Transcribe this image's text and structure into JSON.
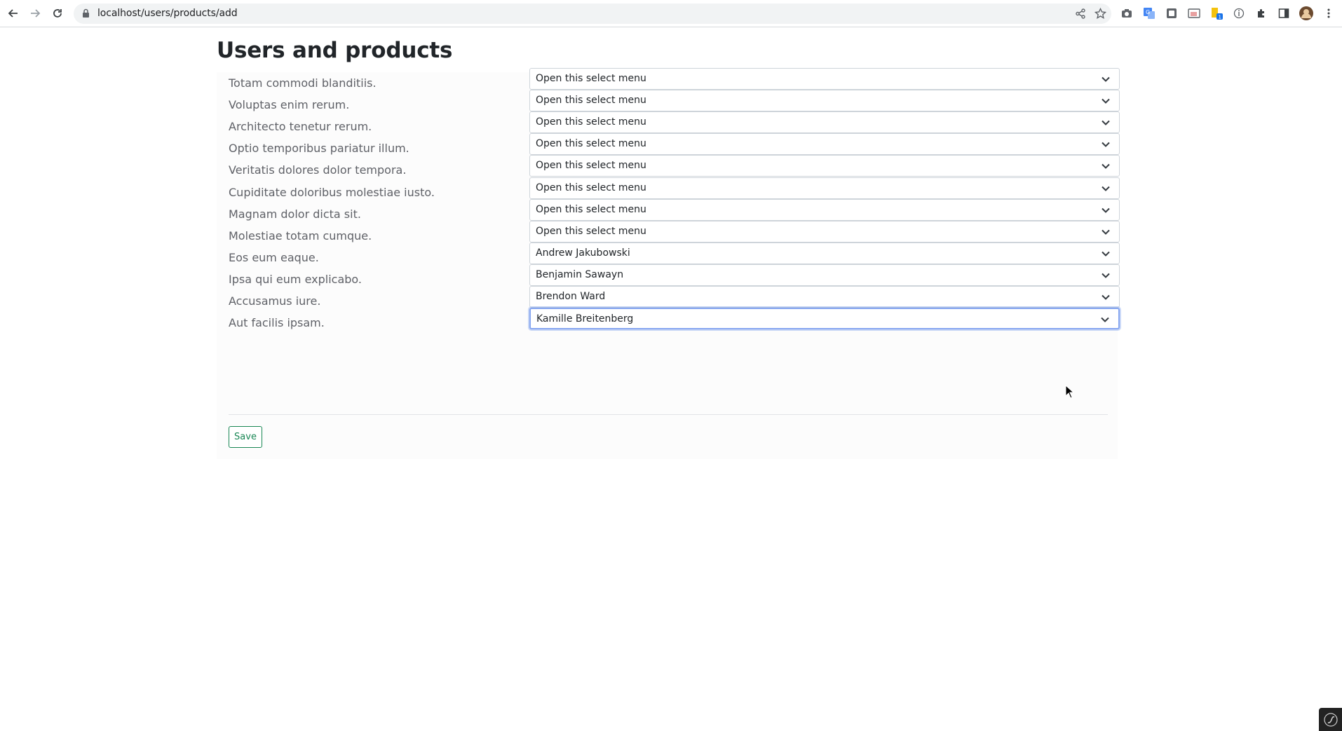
{
  "browser": {
    "url": "localhost/users/products/add"
  },
  "page": {
    "title": "Users and products"
  },
  "form": {
    "rows": [
      {
        "label": "Totam commodi blanditiis.",
        "value": "Open this select menu"
      },
      {
        "label": "Voluptas enim rerum.",
        "value": "Open this select menu"
      },
      {
        "label": "Architecto tenetur rerum.",
        "value": "Open this select menu"
      },
      {
        "label": "Optio temporibus pariatur illum.",
        "value": "Open this select menu"
      },
      {
        "label": "Veritatis dolores dolor tempora.",
        "value": "Open this select menu"
      },
      {
        "label": "Cupiditate doloribus molestiae iusto.",
        "value": "Open this select menu"
      },
      {
        "label": "Magnam dolor dicta sit.",
        "value": "Open this select menu"
      },
      {
        "label": "Molestiae totam cumque.",
        "value": "Open this select menu"
      },
      {
        "label": "Eos eum eaque.",
        "value": "Andrew Jakubowski"
      },
      {
        "label": "Ipsa qui eum explicabo.",
        "value": "Benjamin Sawayn"
      },
      {
        "label": "Accusamus iure.",
        "value": "Brendon Ward"
      },
      {
        "label": "Aut facilis ipsam.",
        "value": "Kamille Breitenberg",
        "focused": true
      }
    ],
    "save_label": "Save"
  },
  "colors": {
    "save_button": "#198754",
    "focus_ring": "#86a6f0"
  }
}
